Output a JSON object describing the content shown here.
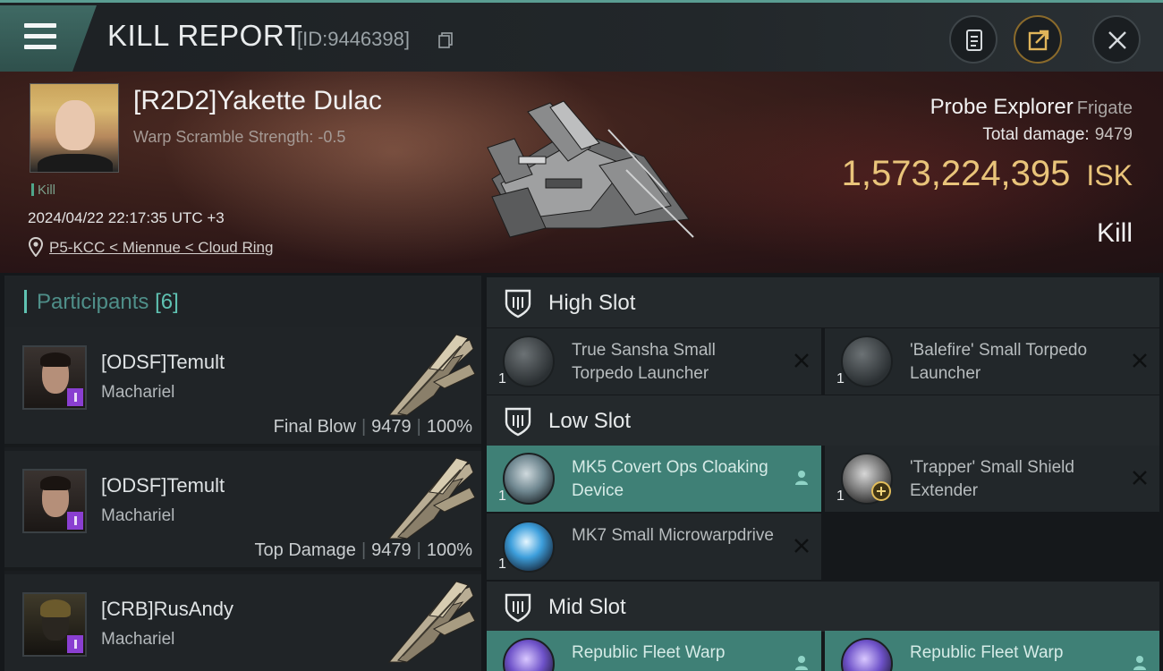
{
  "header": {
    "title": "KILL REPORT",
    "report_id": "[ID:9446398]",
    "icons": [
      "menu-icon",
      "copy-icon",
      "document-icon",
      "share-icon",
      "close-icon"
    ]
  },
  "victim": {
    "name": "[R2D2]Yakette Dulac",
    "warp_scramble": "Warp Scramble Strength: -0.5",
    "tag": "Kill",
    "timestamp": "2024/04/22 22:17:35 UTC +3",
    "location": "P5-KCC < Miennue < Cloud Ring"
  },
  "ship": {
    "name": "Probe Explorer",
    "class": "Frigate",
    "total_damage_label": "Total damage:",
    "total_damage": "9479",
    "isk_value": "1,573,224,395",
    "isk_unit": "ISK",
    "result": "Kill"
  },
  "participants": {
    "title": "Participants",
    "count": "[6]",
    "rows": [
      {
        "name": "[ODSF]Temult",
        "ship": "Machariel",
        "role": "Final Blow",
        "damage": "9479",
        "percent": "100%"
      },
      {
        "name": "[ODSF]Temult",
        "ship": "Machariel",
        "role": "Top Damage",
        "damage": "9479",
        "percent": "100%"
      },
      {
        "name": "[CRB]RusAndy",
        "ship": "Machariel",
        "role": "",
        "damage": "",
        "percent": ""
      }
    ]
  },
  "slots": {
    "high": {
      "label": "High Slot",
      "modules": [
        {
          "qty": "1",
          "name": "True Sansha Small Torpedo Launcher",
          "status": "destroyed",
          "icon": "torpedo-launcher-icon"
        },
        {
          "qty": "1",
          "name": "'Balefire' Small Torpedo Launcher",
          "status": "destroyed",
          "icon": "torpedo-launcher-icon"
        }
      ]
    },
    "low": {
      "label": "Low Slot",
      "modules": [
        {
          "qty": "1",
          "name": "MK5 Covert Ops Cloaking Device",
          "status": "dropped",
          "icon": "cloaking-device-icon"
        },
        {
          "qty": "1",
          "name": "'Trapper' Small Shield Extender",
          "status": "destroyed",
          "icon": "shield-extender-icon"
        },
        {
          "qty": "1",
          "name": "MK7 Small Microwarpdrive",
          "status": "destroyed",
          "icon": "microwarpdrive-icon"
        }
      ]
    },
    "mid": {
      "label": "Mid Slot",
      "modules": [
        {
          "qty": "1",
          "name": "Republic Fleet Warp",
          "status": "dropped",
          "icon": "warp-disruptor-icon"
        },
        {
          "qty": "1",
          "name": "Republic Fleet Warp",
          "status": "dropped",
          "icon": "warp-disruptor-icon"
        }
      ]
    }
  },
  "colors": {
    "accent": "#5fc2b2",
    "dropped_module": "#3f8076",
    "isk_gold": "#e9c47a",
    "corp_badge": "#8a3fd1"
  }
}
